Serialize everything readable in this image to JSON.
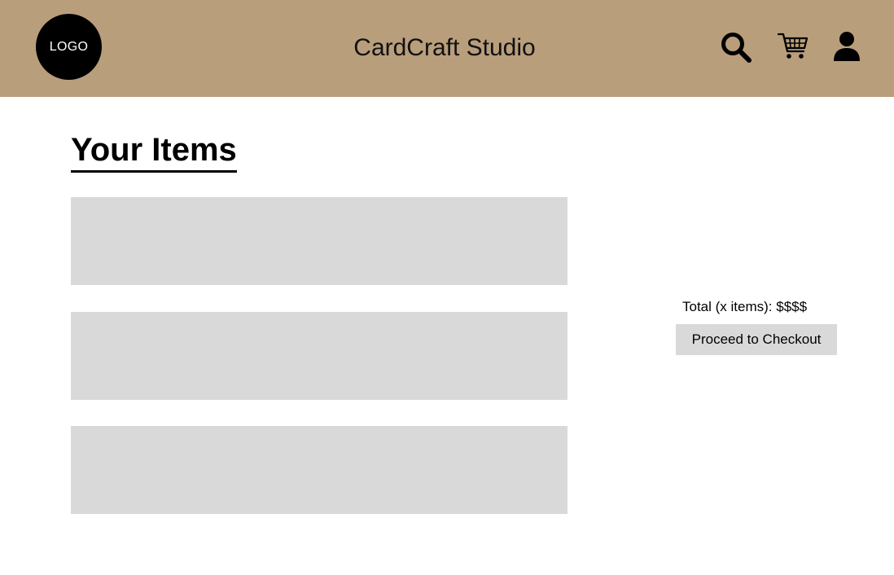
{
  "header": {
    "logo_text": "LOGO",
    "site_title": "CardCraft Studio",
    "icons": [
      "search-icon",
      "cart-icon",
      "user-icon"
    ],
    "background_color": "#b99e7c"
  },
  "main": {
    "heading": "Your Items",
    "item_placeholder_color": "#d9d9d9",
    "items_shown": 3
  },
  "summary": {
    "total_text": "Total (x items): $$$$",
    "checkout_label": "Proceed to Checkout"
  }
}
